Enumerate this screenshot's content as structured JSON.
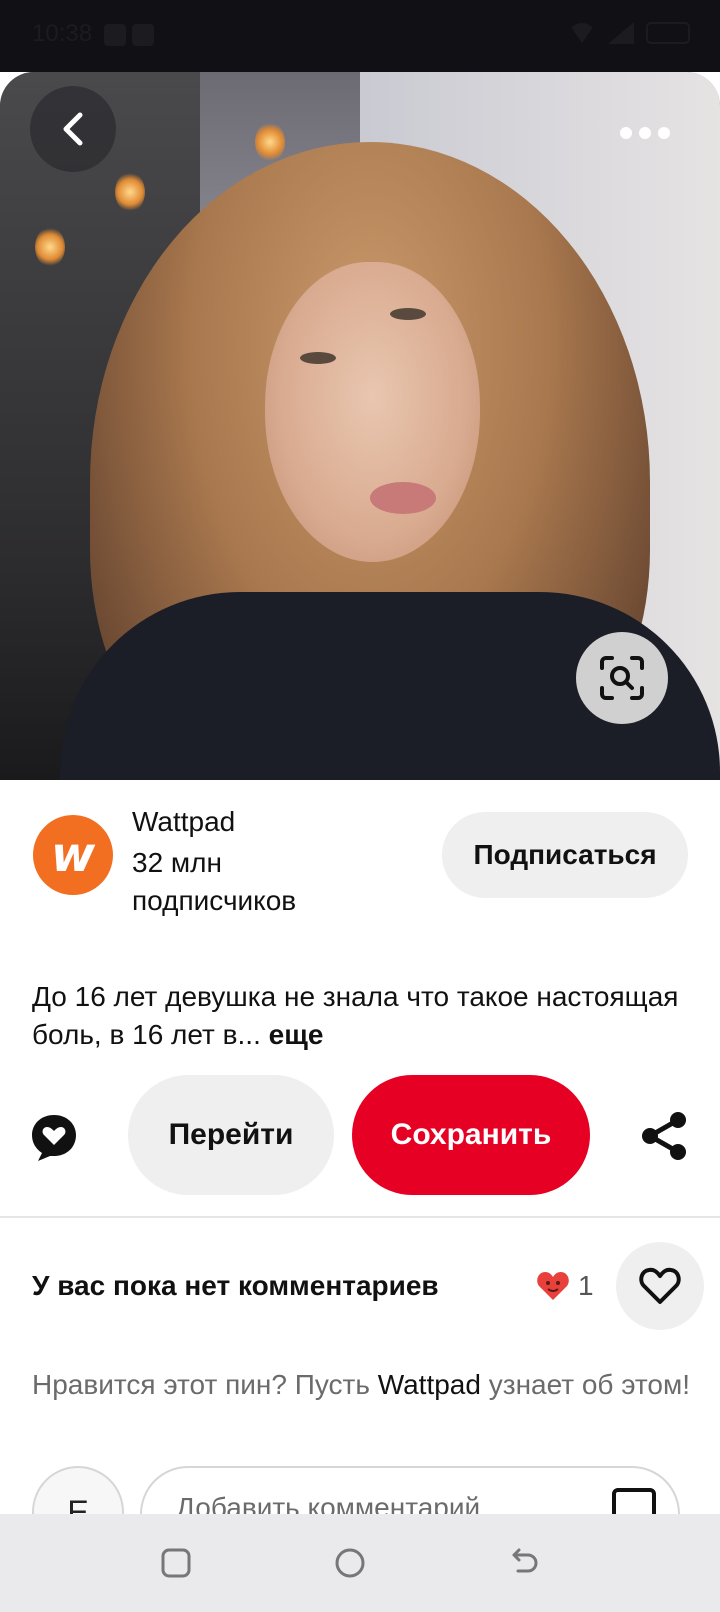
{
  "status_bar": {
    "time": "10:38"
  },
  "pin": {
    "more_label": "•••"
  },
  "profile": {
    "name": "Wattpad",
    "followers": "32 млн подписчиков",
    "follow_label": "Подписаться",
    "logo_letter": "w",
    "brand_color": "#f26f21"
  },
  "description": {
    "text": "До 16 лет девушка не знала что такое настоящая боль, в 16 лет в...",
    "more_label": "еще"
  },
  "actions": {
    "go_label": "Перейти",
    "save_label": "Сохранить",
    "save_color": "#e60023"
  },
  "comments": {
    "title": "У вас пока нет комментариев",
    "reaction_count": "1",
    "nudge_prefix": "Нравится этот пин? Пусть",
    "nudge_brand": "Wattpad",
    "nudge_suffix": "узнает об этом!",
    "avatar_letter": "E",
    "input_placeholder": "Добавить комментарий"
  },
  "icons": [
    "back-icon",
    "more-icon",
    "visual-search-icon",
    "comment-heart-icon",
    "share-icon",
    "heart-reaction-icon",
    "heart-icon",
    "image-icon",
    "recents-icon",
    "home-icon",
    "back-nav-icon"
  ]
}
